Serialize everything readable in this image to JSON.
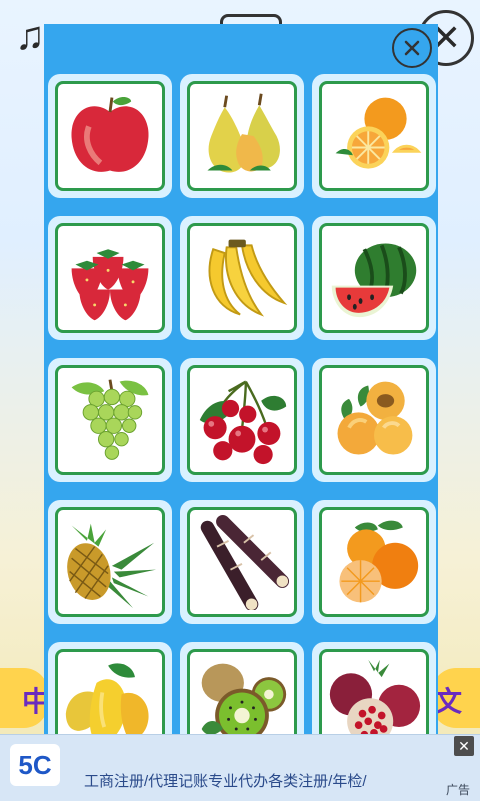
{
  "background": {
    "music_icon": "music-note-icon",
    "center_icon": "tv-icon",
    "close_icon": "close-icon",
    "left_button_char": "中",
    "right_button_char": "文"
  },
  "popup": {
    "close_icon": "close-circle-icon",
    "fruits": [
      {
        "name": "apple"
      },
      {
        "name": "pear"
      },
      {
        "name": "orange"
      },
      {
        "name": "strawberry"
      },
      {
        "name": "banana"
      },
      {
        "name": "watermelon"
      },
      {
        "name": "grape"
      },
      {
        "name": "cherry"
      },
      {
        "name": "apricot"
      },
      {
        "name": "pineapple"
      },
      {
        "name": "sugarcane"
      },
      {
        "name": "tangerine"
      },
      {
        "name": "mango"
      },
      {
        "name": "kiwi"
      },
      {
        "name": "pomegranate"
      }
    ]
  },
  "ad": {
    "logo_text": "5C",
    "text": "工商注册/代理记账专业代办各类注册/年检/",
    "badge": "广告",
    "close_symbol": "✕"
  },
  "colors": {
    "popup_bg": "#35a6ee",
    "tile_border": "#2d9a4c",
    "tile_bg": "#d9f1ff"
  }
}
